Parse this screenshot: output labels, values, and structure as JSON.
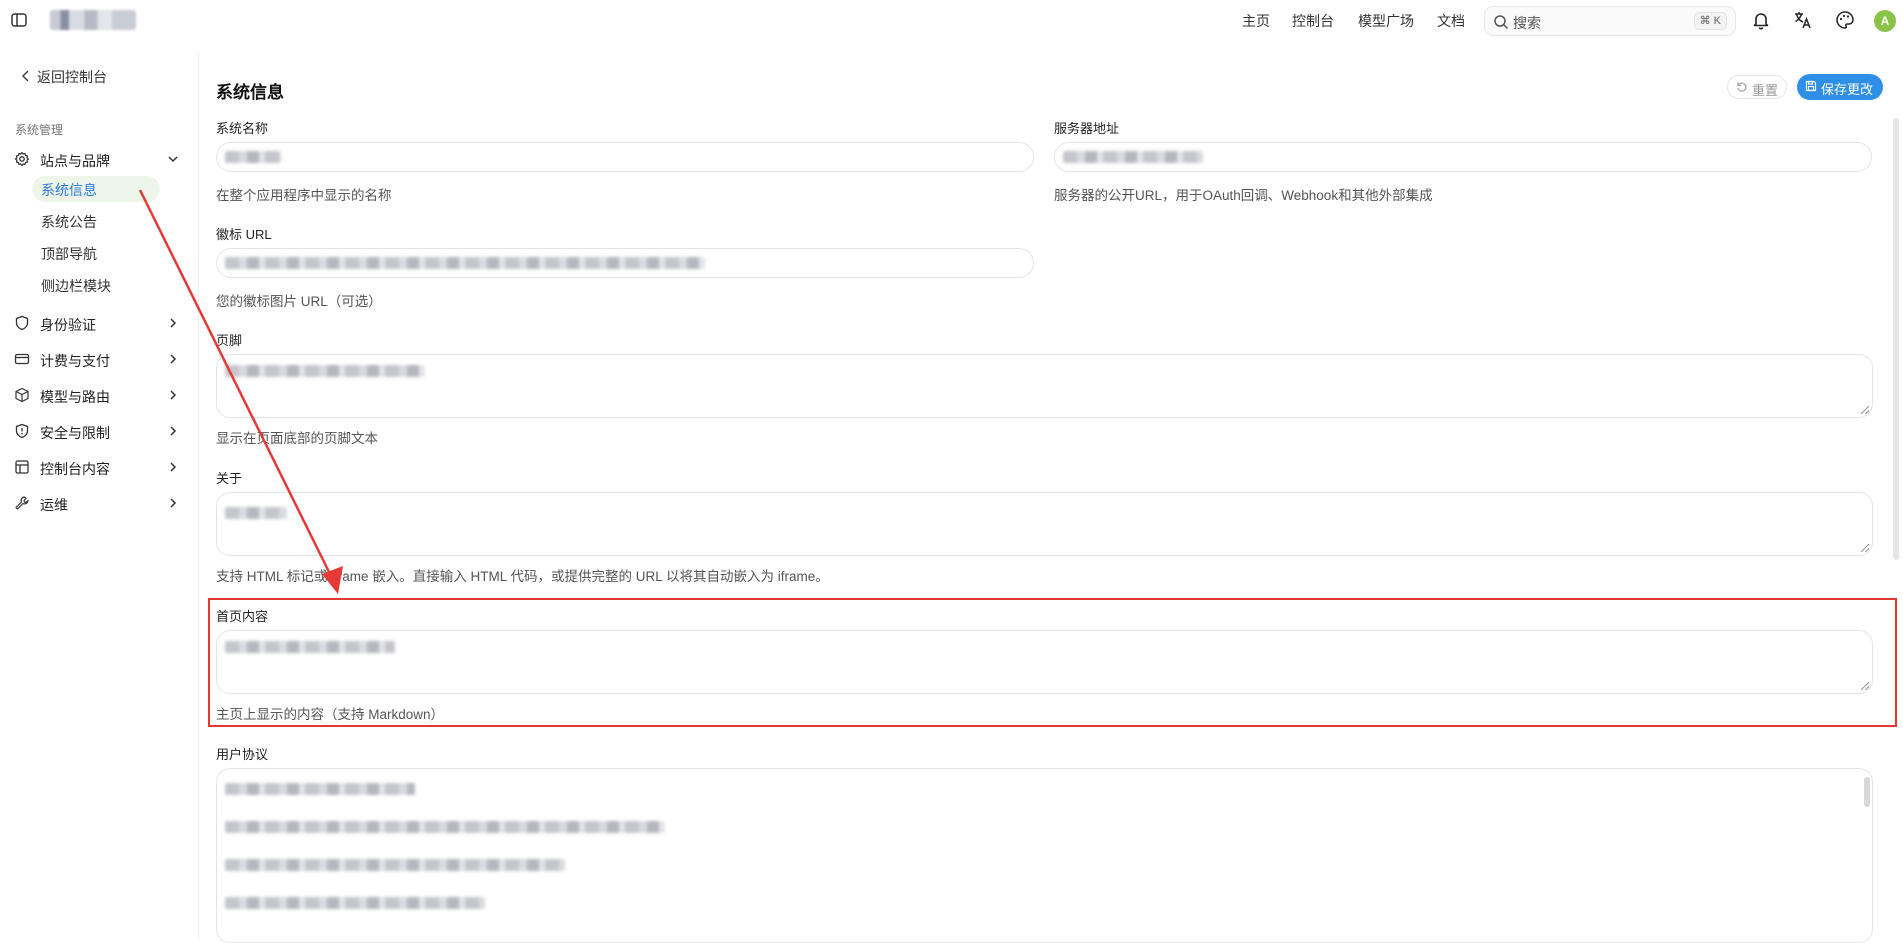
{
  "header": {
    "nav": [
      "主页",
      "控制台",
      "模型广场",
      "文档"
    ],
    "search_placeholder": "搜索",
    "search_shortcut": "⌘ K",
    "avatar_initial": "A",
    "icons": [
      "sidebar-toggle-icon",
      "bell-icon",
      "translate-icon",
      "palette-icon"
    ]
  },
  "sidebar": {
    "back_label": "返回控制台",
    "group_label": "系统管理",
    "items": [
      {
        "label": "站点与品牌",
        "icon": "gear-icon",
        "expanded": true,
        "children": [
          "系统信息",
          "系统公告",
          "顶部导航",
          "侧边栏模块"
        ]
      },
      {
        "label": "身份验证",
        "icon": "shield-icon"
      },
      {
        "label": "计费与支付",
        "icon": "credit-card-icon"
      },
      {
        "label": "模型与路由",
        "icon": "cube-icon"
      },
      {
        "label": "安全与限制",
        "icon": "shield-alert-icon"
      },
      {
        "label": "控制台内容",
        "icon": "layout-icon"
      },
      {
        "label": "运维",
        "icon": "wrench-icon"
      }
    ],
    "active_child": "系统信息"
  },
  "main": {
    "title": "系统信息",
    "reset_label": "重置",
    "save_label": "保存更改",
    "fields": {
      "system_name": {
        "label": "系统名称",
        "hint": "在整个应用程序中显示的名称"
      },
      "server_address": {
        "label": "服务器地址",
        "hint": "服务器的公开URL，用于OAuth回调、Webhook和其他外部集成"
      },
      "favicon_url": {
        "label": "徽标 URL",
        "hint": "您的徽标图片 URL（可选）"
      },
      "footer": {
        "label": "页脚",
        "hint": "显示在页面底部的页脚文本"
      },
      "about": {
        "label": "关于",
        "hint": "支持 HTML 标记或 iframe 嵌入。直接输入 HTML 代码，或提供完整的 URL 以将其自动嵌入为 iframe。"
      },
      "home_content": {
        "label": "首页内容",
        "hint": "主页上显示的内容（支持 Markdown）"
      },
      "user_agreement": {
        "label": "用户协议"
      }
    }
  },
  "annotation": {
    "color": "#e53935"
  }
}
